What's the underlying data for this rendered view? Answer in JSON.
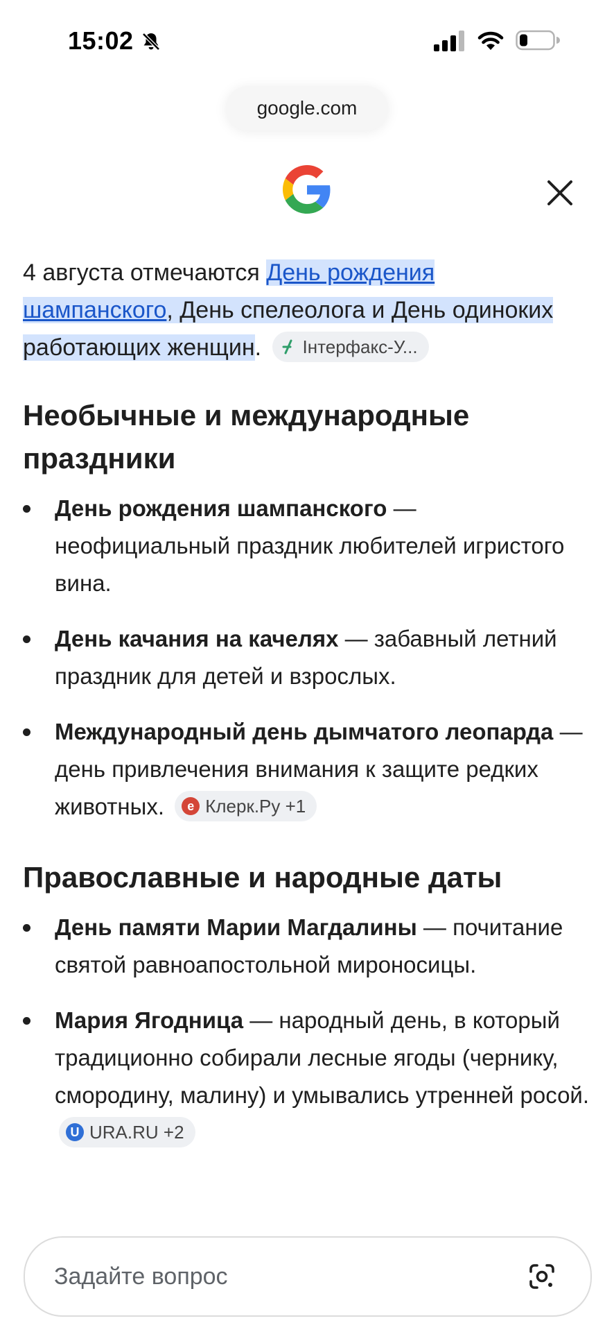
{
  "status_bar": {
    "time": "15:02"
  },
  "browser": {
    "url": "google.com"
  },
  "intro": {
    "prefix": "4 августа отмечаются ",
    "link": "День рождения шампанского",
    "middle": ", День спелеолога и День одиноких работающих женщин",
    "end": ".",
    "source_chip": "Інтерфакс-У..."
  },
  "sections": [
    {
      "title": "Необычные и международные праздники",
      "items": [
        {
          "bold": "День рождения шампанского",
          "text": " — неофициальный праздник любителей игристого вина."
        },
        {
          "bold": "День качания на качелях",
          "text": " — забавный летний праздник для детей и взрослых."
        },
        {
          "bold": "Международный день дымчатого леопарда",
          "text": " — день привлечения внимания к защите редких животных.",
          "chip": "Клерк.Ру +1"
        }
      ]
    },
    {
      "title": "Православные и народные даты",
      "items": [
        {
          "bold": "День памяти Марии Магдалины",
          "text": " — почитание святой равноапостольной мироносицы."
        },
        {
          "bold": "Мария Ягодница",
          "text": " — народный день, в который традиционно собирали лесные ягоды (чернику, смородину, малину) и умывались утренней росой.",
          "chip": "URA.RU +2"
        }
      ]
    }
  ],
  "ask": {
    "placeholder": "Задайте вопрос"
  },
  "icons": {
    "mute": "bell-slash-icon",
    "signal": "cellular-signal-icon",
    "wifi": "wifi-icon",
    "battery": "battery-icon",
    "logo": "google-g-logo",
    "close": "close-icon",
    "lens": "google-lens-icon"
  },
  "colors": {
    "link": "#1a56c9",
    "highlight": "#d3e3fd",
    "chip_bg": "#eef0f3"
  }
}
